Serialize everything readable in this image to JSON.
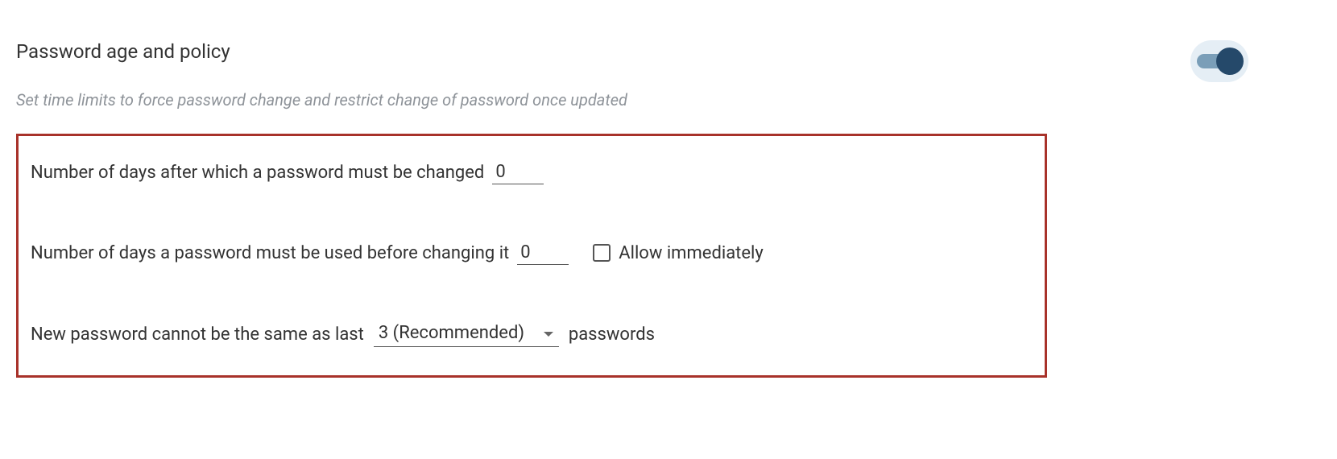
{
  "section": {
    "title": "Password age and policy",
    "subtitle": "Set time limits to force password change and restrict change of password once updated",
    "toggle_on": true
  },
  "rows": {
    "max_age": {
      "label": "Number of days after which a password must be changed",
      "value": "0"
    },
    "min_age": {
      "label": "Number of days a password must be used before changing it",
      "value": "0",
      "allow_label": "Allow immediately"
    },
    "history": {
      "label_before": "New password cannot be the same as last",
      "select_value": "3 (Recommended)",
      "label_after": "passwords"
    }
  }
}
